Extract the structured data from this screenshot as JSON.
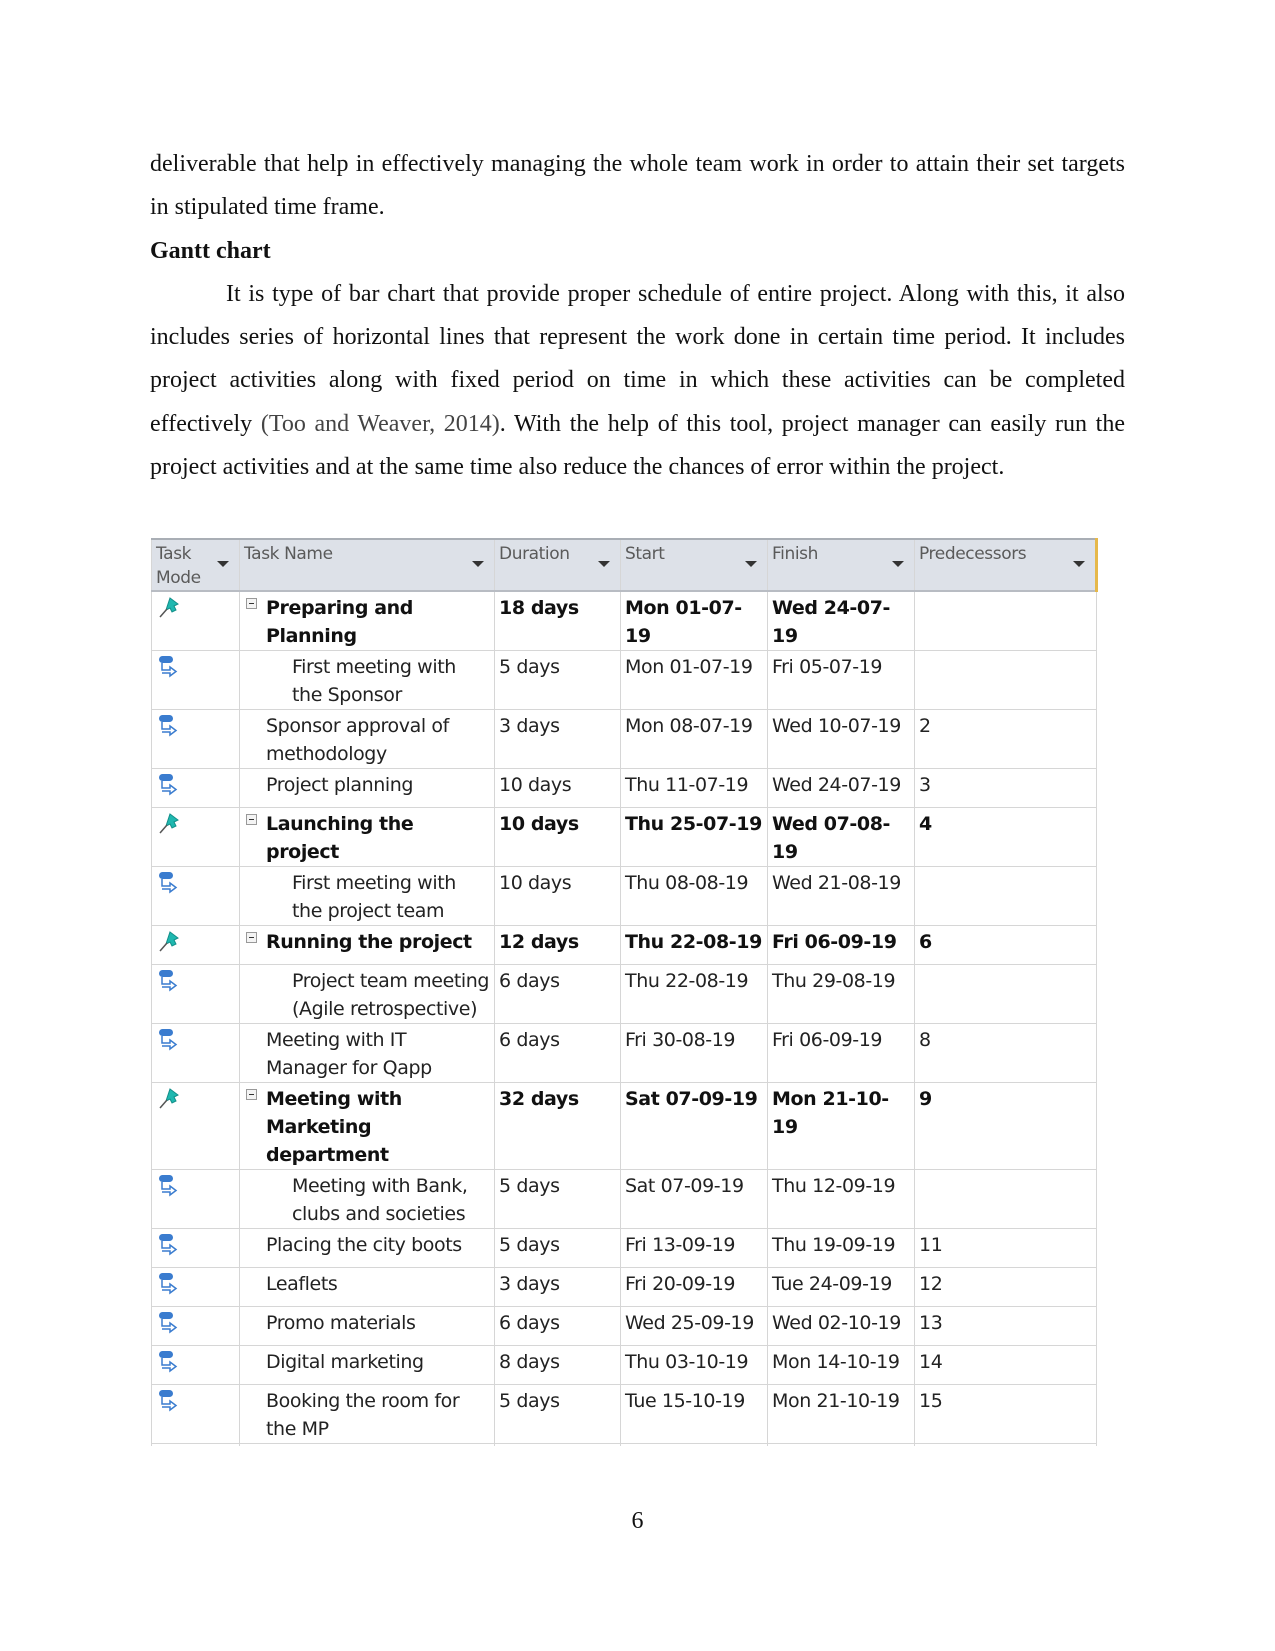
{
  "document": {
    "para1_line": "deliverable that help in effectively managing the whole team work in order to attain their set targets in stipulated time frame.",
    "heading": "Gantt chart",
    "para2_before_cite": "It is type of bar chart that provide proper schedule of entire project. Along with this, it also includes series of horizontal lines that represent the work done in certain time period. It includes project activities along with fixed period on time in which these activities can be completed effectively ",
    "para2_cite": "(Too and Weaver, 2014)",
    "para2_after_cite": ". With the help of this tool, project manager can easily run the project activities and at the same time also reduce the chances of error within the project.",
    "page_number": "6"
  },
  "table": {
    "headers": {
      "task_mode": "Task Mode",
      "task_name": "Task Name",
      "duration": "Duration",
      "start": "Start",
      "finish": "Finish",
      "predecessors": "Predecessors"
    },
    "rows": [
      {
        "mode": "manual-pin-icon",
        "name": "Preparing and Planning",
        "level": "summary",
        "duration": "18 days",
        "start": "Mon 01-07-19",
        "finish": "Wed 24-07-19",
        "pred": ""
      },
      {
        "mode": "auto-schedule-icon",
        "name": "First meeting with the Sponsor",
        "level": "sub2",
        "duration": "5 days",
        "start": "Mon 01-07-19",
        "finish": "Fri 05-07-19",
        "pred": ""
      },
      {
        "mode": "auto-schedule-icon",
        "name": "Sponsor approval of methodology",
        "level": "sub",
        "duration": "3 days",
        "start": "Mon 08-07-19",
        "finish": "Wed 10-07-19",
        "pred": "2"
      },
      {
        "mode": "auto-schedule-icon",
        "name": "Project planning",
        "level": "sub",
        "duration": "10 days",
        "start": "Thu 11-07-19",
        "finish": "Wed 24-07-19",
        "pred": "3"
      },
      {
        "mode": "manual-pin-icon",
        "name": "Launching the project",
        "level": "summary",
        "duration": "10 days",
        "start": "Thu 25-07-19",
        "finish": "Wed 07-08-19",
        "pred": "4"
      },
      {
        "mode": "auto-schedule-icon",
        "name": "First meeting with the project team",
        "level": "sub2",
        "duration": "10 days",
        "start": "Thu 08-08-19",
        "finish": "Wed 21-08-19",
        "pred": ""
      },
      {
        "mode": "manual-pin-icon",
        "name": "Running the project",
        "level": "summary",
        "duration": "12 days",
        "start": "Thu 22-08-19",
        "finish": "Fri 06-09-19",
        "pred": "6"
      },
      {
        "mode": "auto-schedule-icon",
        "name": "Project team meeting (Agile retrospective)",
        "level": "sub2",
        "duration": "6 days",
        "start": "Thu 22-08-19",
        "finish": "Thu 29-08-19",
        "pred": ""
      },
      {
        "mode": "auto-schedule-icon",
        "name": "Meeting with IT Manager for Qapp",
        "level": "sub",
        "duration": "6 days",
        "start": "Fri 30-08-19",
        "finish": "Fri 06-09-19",
        "pred": "8"
      },
      {
        "mode": "manual-pin-icon",
        "name": "Meeting with Marketing department",
        "level": "summary",
        "duration": "32 days",
        "start": "Sat 07-09-19",
        "finish": "Mon 21-10-19",
        "pred": "9"
      },
      {
        "mode": "auto-schedule-icon",
        "name": "Meeting with Bank, clubs and societies",
        "level": "sub2",
        "duration": "5 days",
        "start": "Sat 07-09-19",
        "finish": "Thu 12-09-19",
        "pred": ""
      },
      {
        "mode": "auto-schedule-icon",
        "name": "Placing the city boots",
        "level": "sub",
        "duration": "5 days",
        "start": "Fri 13-09-19",
        "finish": "Thu 19-09-19",
        "pred": "11"
      },
      {
        "mode": "auto-schedule-icon",
        "name": "Leaflets",
        "level": "sub",
        "duration": "3 days",
        "start": "Fri 20-09-19",
        "finish": "Tue 24-09-19",
        "pred": "12"
      },
      {
        "mode": "auto-schedule-icon",
        "name": "Promo materials",
        "level": "sub",
        "duration": "6 days",
        "start": "Wed 25-09-19",
        "finish": "Wed 02-10-19",
        "pred": "13"
      },
      {
        "mode": "auto-schedule-icon",
        "name": "Digital marketing",
        "level": "sub",
        "duration": "8 days",
        "start": "Thu 03-10-19",
        "finish": "Mon 14-10-19",
        "pred": "14"
      },
      {
        "mode": "auto-schedule-icon",
        "name": "Booking the room for the MP",
        "level": "sub",
        "duration": "5 days",
        "start": "Tue 15-10-19",
        "finish": "Mon 21-10-19",
        "pred": "15"
      }
    ]
  },
  "colors": {
    "header_bg": "#dde1e8",
    "pin_icon": "#1fb8b0",
    "auto_icon": "#3a7ccf",
    "accent_border": "#e6b84a"
  }
}
